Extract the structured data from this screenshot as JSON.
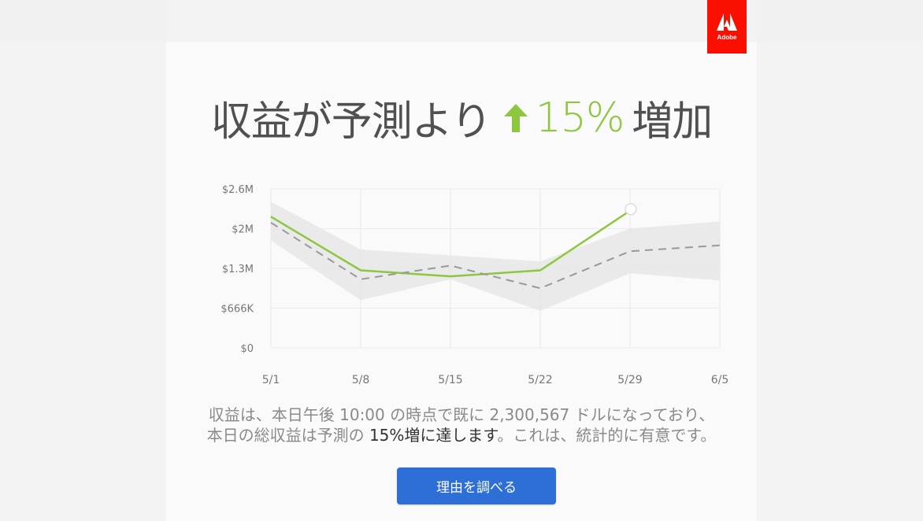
{
  "brand": {
    "logo_text": "Adobe",
    "color": "#fa0f00"
  },
  "headline": {
    "prefix": "収益が予測より",
    "percent": "15%",
    "suffix": "増加",
    "accent_color": "#8dc63f"
  },
  "chart_data": {
    "type": "line",
    "title": "",
    "xlabel": "",
    "ylabel": "",
    "categories": [
      "5/1",
      "5/8",
      "5/15",
      "5/22",
      "5/29",
      "6/5"
    ],
    "y_tick_labels": [
      "$0",
      "$666K",
      "$1.3M",
      "$2M",
      "$2.6M"
    ],
    "y_tick_values": [
      0,
      666000,
      1333000,
      2000000,
      2666000
    ],
    "ylim": [
      0,
      2666000
    ],
    "grid": true,
    "series": [
      {
        "style": "solid",
        "color": "#8dc63f",
        "values": [
          2200000,
          1300000,
          1200000,
          1300000,
          2300000,
          null
        ]
      },
      {
        "style": "dashed",
        "color": "#999999",
        "values": [
          2100000,
          1150000,
          1380000,
          1000000,
          1620000,
          1720000
        ]
      }
    ],
    "band": {
      "color": "#e6e6e6",
      "upper": [
        2450000,
        1650000,
        1550000,
        1450000,
        2000000,
        2120000
      ],
      "lower": [
        1800000,
        800000,
        1150000,
        620000,
        1250000,
        1130000
      ]
    },
    "highlight_point": {
      "category": "5/29",
      "value": 2300000
    }
  },
  "body": {
    "line1": "収益は、本日午後 10:00 の時点で既に 2,300,567 ドルになっており、",
    "line2_a": "本日の総収益は予測の ",
    "line2_b": "15%増に達します",
    "line2_c": "。これは、統計的に有意です。"
  },
  "cta": {
    "label": "理由を調べる"
  }
}
